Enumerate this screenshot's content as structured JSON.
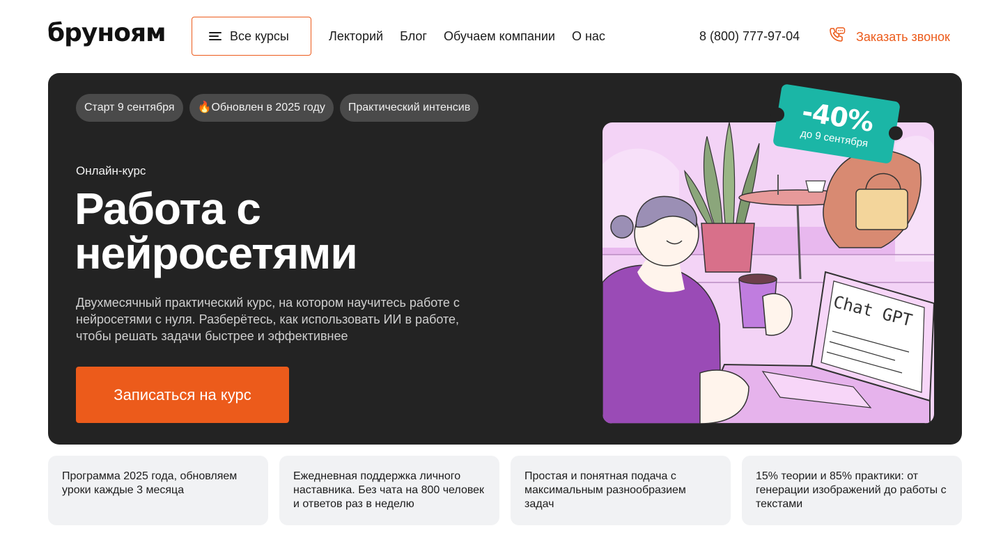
{
  "header": {
    "logo": "бруноям",
    "all_courses_label": "Все курсы",
    "nav": [
      "Лекторий",
      "Блог",
      "Обучаем компании",
      "О нас"
    ],
    "phone": "8 (800) 777-97-04",
    "callback_label": "Заказать звонок"
  },
  "hero": {
    "tags": [
      "Старт 9 сентября",
      "🔥Обновлен в 2025 году",
      "Практический интенсив"
    ],
    "kicker": "Онлайн-курс",
    "title_line1": "Работа с",
    "title_line2": "нейросетями",
    "description": "Двухмесячный практический курс, на котором научитесь работе с нейросетями с нуля. Разберётесь, как использовать ИИ в работе, чтобы решать задачи быстрее и эффективнее",
    "cta_label": "Записаться на курс",
    "discount": {
      "percent": "-40%",
      "until": "до 9 сентября"
    },
    "illustration_text": "Chat GPT"
  },
  "features": [
    "Программа 2025 года, обновляем уроки каждые 3 месяца",
    "Ежедневная поддержка личного наставника. Без чата на 800 человек и ответов раз в неделю",
    "Простая и понятная подача с максимальным разнообразием задач",
    "15% теории и 85% практики: от генерации изображений до работы с текстами"
  ],
  "colors": {
    "accent": "#ec5b1b",
    "hero_bg": "#232323",
    "badge": "#1bb6a6",
    "card_bg": "#f1f2f4"
  }
}
